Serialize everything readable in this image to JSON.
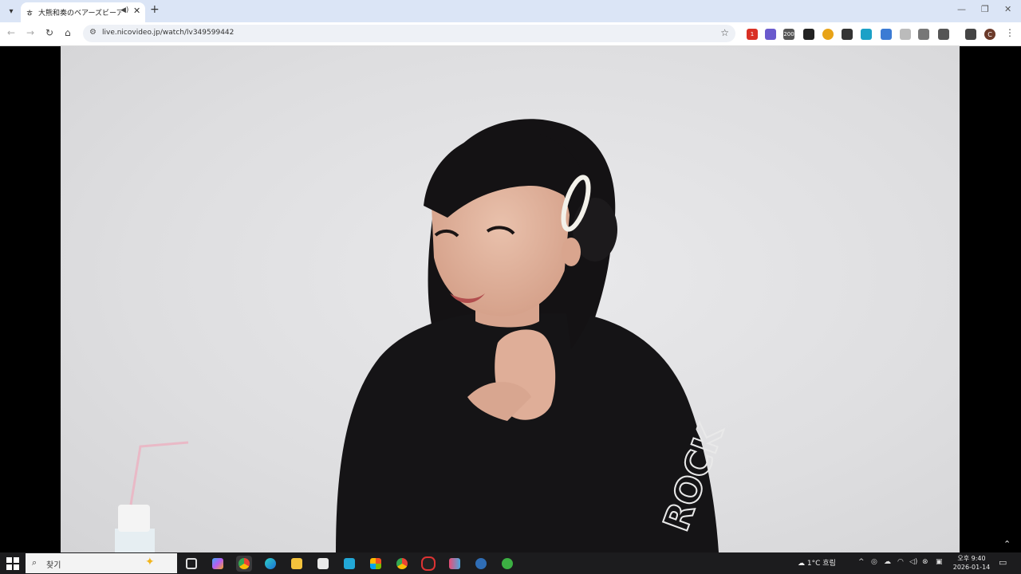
{
  "browser": {
    "tab": {
      "title": "大熊和奏のベアーズビーアンビ",
      "favicon": "nico-icon",
      "audio": "speaker-icon"
    },
    "new_tab_label": "+",
    "address": "live.nicovideo.jp/watch/lv349599442",
    "extensions": [
      {
        "name": "ext-red",
        "badge": "1",
        "color": "#d93025"
      },
      {
        "name": "ext-purple",
        "badge": "",
        "color": "#6a5acd"
      },
      {
        "name": "ext-counter",
        "badge": "200",
        "color": "#555555"
      },
      {
        "name": "ext-dark",
        "badge": "",
        "color": "#222222"
      },
      {
        "name": "ext-color",
        "badge": "",
        "color": "#e8a317"
      },
      {
        "name": "ext-kanji",
        "badge": "",
        "color": "#333333"
      },
      {
        "name": "ext-teal",
        "badge": "",
        "color": "#1ba1c7"
      },
      {
        "name": "ext-blue",
        "badge": "",
        "color": "#3b7bd4"
      },
      {
        "name": "ext-gray",
        "badge": "",
        "color": "#999999"
      },
      {
        "name": "ext-chat",
        "badge": "",
        "color": "#666666"
      },
      {
        "name": "ext-puzzle",
        "badge": "",
        "color": "#444444"
      }
    ],
    "profile_initial": "C"
  },
  "taskbar": {
    "search_placeholder": "찾기",
    "weather": "1°C  흐림",
    "time": "오후 9:40",
    "date": "2026-01-14"
  }
}
